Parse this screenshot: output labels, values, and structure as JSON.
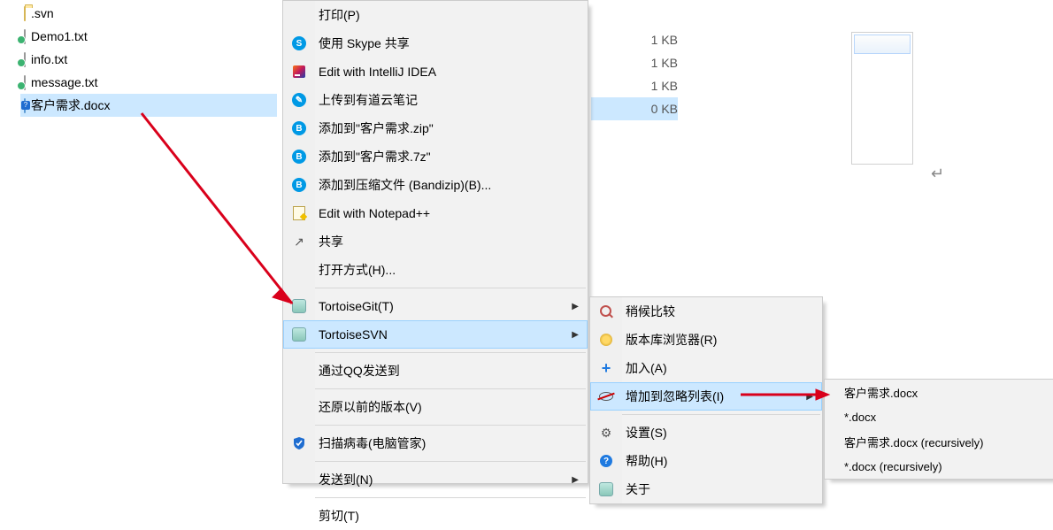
{
  "files": [
    {
      "name": ".svn",
      "kind": "folder",
      "size": ""
    },
    {
      "name": "Demo1.txt",
      "kind": "txt",
      "size": "1 KB"
    },
    {
      "name": "info.txt",
      "kind": "txt",
      "size": "1 KB"
    },
    {
      "name": "message.txt",
      "kind": "txt",
      "size": "1 KB"
    },
    {
      "name": "客户需求.docx",
      "kind": "docx",
      "size": "0 KB",
      "selected": true
    }
  ],
  "context_menu": {
    "items": [
      {
        "label": "打印(P)",
        "icon": ""
      },
      {
        "label": "使用 Skype 共享",
        "icon": "skype"
      },
      {
        "label": "Edit with IntelliJ IDEA",
        "icon": "intellij"
      },
      {
        "label": "上传到有道云笔记",
        "icon": "youdao"
      },
      {
        "label": "添加到\"客户需求.zip\"",
        "icon": "bandizip"
      },
      {
        "label": "添加到\"客户需求.7z\"",
        "icon": "bandizip"
      },
      {
        "label": "添加到压缩文件 (Bandizip)(B)...",
        "icon": "bandizip"
      },
      {
        "label": "Edit with Notepad++",
        "icon": "notepad"
      },
      {
        "label": "共享",
        "icon": "share"
      },
      {
        "label": "打开方式(H)...",
        "icon": ""
      },
      {
        "sep": true
      },
      {
        "label": "TortoiseGit(T)",
        "icon": "tortoise",
        "submenu": true
      },
      {
        "label": "TortoiseSVN",
        "icon": "tortoise",
        "submenu": true,
        "hover": true
      },
      {
        "sep": true
      },
      {
        "label": "通过QQ发送到",
        "icon": ""
      },
      {
        "sep": true
      },
      {
        "label": "还原以前的版本(V)",
        "icon": ""
      },
      {
        "sep": true
      },
      {
        "label": "扫描病毒(电脑管家)",
        "icon": "shield"
      },
      {
        "sep": true
      },
      {
        "label": "发送到(N)",
        "icon": "",
        "submenu": true
      },
      {
        "sep": true
      },
      {
        "label": "剪切(T)",
        "icon": ""
      }
    ]
  },
  "svn_menu": {
    "items": [
      {
        "label": "稍候比较",
        "icon": "mag"
      },
      {
        "label": "版本库浏览器(R)",
        "icon": "repo"
      },
      {
        "label": "加入(A)",
        "icon": "plus"
      },
      {
        "label": "增加到忽略列表(I)",
        "icon": "noeye",
        "submenu": true,
        "hover": true
      },
      {
        "sep": true
      },
      {
        "label": "设置(S)",
        "icon": "gear"
      },
      {
        "label": "帮助(H)",
        "icon": "help"
      },
      {
        "label": "关于",
        "icon": "tortoise"
      }
    ]
  },
  "ignore_menu": {
    "items": [
      {
        "label": "客户需求.docx"
      },
      {
        "label": "*.docx"
      },
      {
        "label": "客户需求.docx (recursively)"
      },
      {
        "label": "*.docx (recursively)"
      }
    ]
  }
}
